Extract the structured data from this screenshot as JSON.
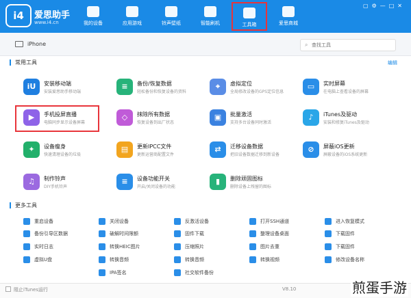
{
  "app": {
    "logo_glyph": "i4",
    "name": "爱思助手",
    "url": "www.i4.cn"
  },
  "nav": [
    {
      "label": "我的设备",
      "icon": "apple-icon"
    },
    {
      "label": "应用游戏",
      "icon": "app-store-icon"
    },
    {
      "label": "铃声壁纸",
      "icon": "music-icon"
    },
    {
      "label": "智能刷机",
      "icon": "shield-icon"
    },
    {
      "label": "工具箱",
      "icon": "toolbox-icon",
      "selected": true
    },
    {
      "label": "爱思商城",
      "icon": "shop-bag-icon"
    }
  ],
  "device": {
    "name": "iPhone"
  },
  "search": {
    "placeholder": "查找工具"
  },
  "sections": {
    "common": "常用工具",
    "more": "更多工具",
    "edit": "编辑"
  },
  "tools": [
    {
      "name": "安装移动端",
      "desc": "安装爱思助手移动端",
      "glyph": "iU",
      "color": "#1f7fe0"
    },
    {
      "name": "备份/恢复数据",
      "desc": "轻松备份和恢复设备的资料",
      "glyph": "≡",
      "color": "#27b37a"
    },
    {
      "name": "虚拟定位",
      "desc": "全局修改设备的GPS定位信息",
      "glyph": "⌖",
      "color": "#5a8de6"
    },
    {
      "name": "实时屏幕",
      "desc": "在电脑上查看设备的屏幕",
      "glyph": "▭",
      "color": "#2a8ee8"
    },
    {
      "name": "手机投屏直播",
      "desc": "电脑同步显示设备屏幕",
      "glyph": "▶",
      "color": "#8e63e8"
    },
    {
      "name": "抹除所有数据",
      "desc": "恢复设备到出厂状态",
      "glyph": "◇",
      "color": "#c05bd8"
    },
    {
      "name": "批量激活",
      "desc": "支持多台设备同时激活",
      "glyph": "▣",
      "color": "#3b82e0"
    },
    {
      "name": "iTunes及驱动",
      "desc": "安装和修复iTunes及驱动",
      "glyph": "♪",
      "color": "#2aa6e8"
    },
    {
      "name": "设备瘦身",
      "desc": "快速清理设备的垃圾",
      "glyph": "✦",
      "color": "#22b06b"
    },
    {
      "name": "更新IPCC文件",
      "desc": "更新运营商配置文件",
      "glyph": "▤",
      "color": "#f2a51f"
    },
    {
      "name": "迁移设备数据",
      "desc": "把旧设备数据迁移到新设备",
      "glyph": "⇄",
      "color": "#2a8ee8"
    },
    {
      "name": "屏蔽iOS更新",
      "desc": "屏蔽设备的iOS系统更新",
      "glyph": "⊘",
      "color": "#2a8ee8"
    },
    {
      "name": "制作铃声",
      "desc": "DIY手机铃声",
      "glyph": "♫",
      "color": "#9b6ae0"
    },
    {
      "name": "设备功能开关",
      "desc": "开启/关闭设备的功能",
      "glyph": "≡",
      "color": "#2a8ee8"
    },
    {
      "name": "删除顽固图标",
      "desc": "删除设备上残留的图标",
      "glyph": "▮",
      "color": "#27b37a"
    }
  ],
  "more_tools": [
    "重启设备",
    "关闭设备",
    "反激活设备",
    "打开SSH通道",
    "进入恢复模式",
    "备份引导区数据",
    "破解时间限额",
    "固件下载",
    "整理设备桌面",
    "下载固件",
    "实时日志",
    "转换HEIC图片",
    "压缩照片",
    "图片去重",
    "下载固件",
    "虚拟U盘",
    "转换音频",
    "转换音频",
    "转换视频",
    "修改设备名称",
    "",
    "IPA签名",
    "社交软件备份",
    "",
    ""
  ],
  "footer": {
    "itunes": "阻止iTunes运行",
    "version": "V8.10"
  },
  "watermark": "煎蛋手游"
}
